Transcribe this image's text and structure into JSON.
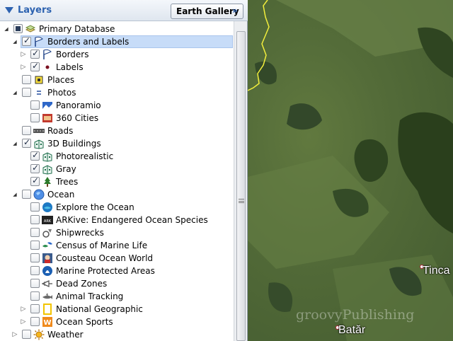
{
  "header": {
    "title": "Layers",
    "gallery_label": "Earth Gallery",
    "gallery_chevron": "»"
  },
  "tree": [
    {
      "label": "Primary Database",
      "icon": "database-icon",
      "depth": 0,
      "expand": "open",
      "check": "partial",
      "selected": false
    },
    {
      "label": "Borders and Labels",
      "icon": "flag-icon",
      "depth": 1,
      "expand": "open",
      "check": "checked",
      "selected": true
    },
    {
      "label": "Borders",
      "icon": "flag-icon",
      "depth": 2,
      "expand": "closed",
      "check": "checked",
      "selected": false
    },
    {
      "label": "Labels",
      "icon": "dot-icon",
      "depth": 2,
      "expand": "closed",
      "check": "checked",
      "selected": false
    },
    {
      "label": "Places",
      "icon": "places-icon",
      "depth": 1,
      "expand": "none",
      "check": "empty",
      "selected": false
    },
    {
      "label": "Photos",
      "icon": "photos-icon",
      "depth": 1,
      "expand": "open",
      "check": "empty",
      "selected": false
    },
    {
      "label": "Panoramio",
      "icon": "panoramio-icon",
      "depth": 2,
      "expand": "none",
      "check": "empty",
      "selected": false
    },
    {
      "label": "360 Cities",
      "icon": "cities-icon",
      "depth": 2,
      "expand": "none",
      "check": "empty",
      "selected": false
    },
    {
      "label": "Roads",
      "icon": "road-icon",
      "depth": 1,
      "expand": "none",
      "check": "empty",
      "selected": false
    },
    {
      "label": "3D Buildings",
      "icon": "building-icon",
      "depth": 1,
      "expand": "open",
      "check": "checked",
      "selected": false
    },
    {
      "label": "Photorealistic",
      "icon": "building-icon",
      "depth": 2,
      "expand": "none",
      "check": "checked",
      "selected": false
    },
    {
      "label": "Gray",
      "icon": "building-icon",
      "depth": 2,
      "expand": "none",
      "check": "checked",
      "selected": false
    },
    {
      "label": "Trees",
      "icon": "tree-icon",
      "depth": 2,
      "expand": "none",
      "check": "checked",
      "selected": false
    },
    {
      "label": "Ocean",
      "icon": "globe-icon",
      "depth": 1,
      "expand": "open",
      "check": "empty",
      "selected": false
    },
    {
      "label": "Explore the Ocean",
      "icon": "ocean-globe-icon",
      "depth": 2,
      "expand": "none",
      "check": "empty",
      "selected": false
    },
    {
      "label": "ARKive: Endangered Ocean Species",
      "icon": "arkive-icon",
      "depth": 2,
      "expand": "none",
      "check": "empty",
      "selected": false
    },
    {
      "label": "Shipwrecks",
      "icon": "shipwreck-icon",
      "depth": 2,
      "expand": "none",
      "check": "empty",
      "selected": false
    },
    {
      "label": "Census of Marine Life",
      "icon": "marine-life-icon",
      "depth": 2,
      "expand": "none",
      "check": "empty",
      "selected": false
    },
    {
      "label": "Cousteau Ocean World",
      "icon": "cousteau-icon",
      "depth": 2,
      "expand": "none",
      "check": "empty",
      "selected": false
    },
    {
      "label": "Marine Protected Areas",
      "icon": "protected-areas-icon",
      "depth": 2,
      "expand": "none",
      "check": "empty",
      "selected": false
    },
    {
      "label": "Dead Zones",
      "icon": "dead-zones-icon",
      "depth": 2,
      "expand": "none",
      "check": "empty",
      "selected": false
    },
    {
      "label": "Animal Tracking",
      "icon": "shark-icon",
      "depth": 2,
      "expand": "none",
      "check": "empty",
      "selected": false
    },
    {
      "label": "National Geographic",
      "icon": "natgeo-icon",
      "depth": 2,
      "expand": "closed",
      "check": "empty",
      "selected": false
    },
    {
      "label": "Ocean Sports",
      "icon": "ocean-sports-icon",
      "depth": 2,
      "expand": "closed",
      "check": "empty",
      "selected": false
    },
    {
      "label": "Weather",
      "icon": "sun-icon",
      "depth": 1,
      "expand": "closed",
      "check": "empty",
      "selected": false
    }
  ],
  "map": {
    "places": [
      {
        "name": "Tinca",
        "pin": "place-pin-icon"
      },
      {
        "name": "Batăr",
        "pin": "place-pin-icon"
      }
    ],
    "watermark": "groovyPublishing",
    "border_color": "#f2ee3c"
  },
  "colors": {
    "accent": "#2d62b0",
    "selection": "#c7dcf8"
  }
}
